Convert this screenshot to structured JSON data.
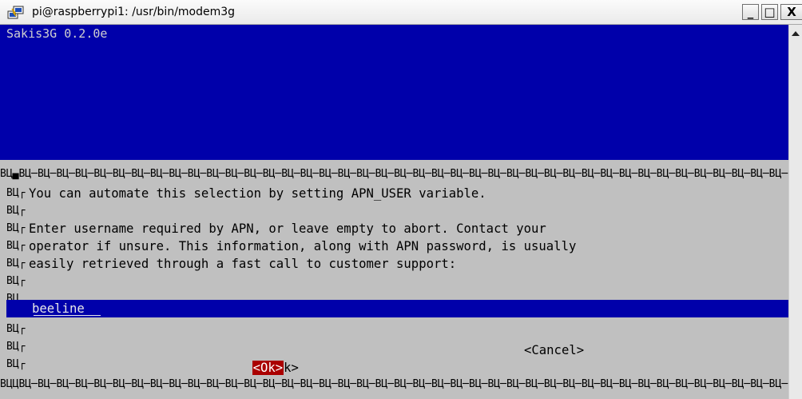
{
  "window": {
    "title": "pi@raspberrypi1: /usr/bin/modem3g",
    "minimize_label": "_",
    "maximize_label": "□",
    "close_label": "X"
  },
  "terminal": {
    "backtitle": "Sakis3G 0.2.0e",
    "border_glyph_row": "ВЦ▄ВЦ─ВЦ─ВЦ─ВЦ─ВЦ─ВЦ─ВЦ─ВЦ─ВЦ─ВЦ─ВЦ─ВЦ─ВЦ─ВЦ─ВЦ─ВЦ─ВЦ─ВЦ─ВЦ─ВЦ─ВЦ─ВЦ─ВЦ─ВЦ─ВЦ─ВЦ─ВЦ─ВЦ─ВЦ─ВЦ─ВЦ─ВЦ─ВЦ─ВЦ─ВЦ─ВЦ─ВЦ─ВЦ─ВЦ─ВЦ─ВЦ─ВЦ─ВЦ─ВЦ─",
    "border_glyph_row_bottom": "ВЦЦВЦ─ВЦ─ВЦ─ВЦ─ВЦ─ВЦ─ВЦ─ВЦ─ВЦ─ВЦ─ВЦ─ВЦ─ВЦ─ВЦ─ВЦ─ВЦ─ВЦ─ВЦ─ВЦ─ВЦ─ВЦ─ВЦ─ВЦ─ВЦ─ВЦ─ВЦ─ВЦ─ВЦ─ВЦ─ВЦ─ВЦ─ВЦ─ВЦ─ВЦ─ВЦ─ВЦ─ВЦ─ВЦ─ВЦ─ВЦ─ВЦ─ВЦ─ВЦ─ВЦ─",
    "left_glyph": "ВЦ┌",
    "left_glyph_plain": "ВЦ"
  },
  "dialog": {
    "lines": [
      "You can automate this selection by setting APN_USER variable.",
      "",
      "Enter username required by APN, or leave empty to abort. Contact your",
      "operator if unsure. This information, along with APN password, is usually",
      "easily retrieved through a fast call to customer support:"
    ],
    "input_value": "beeline",
    "ok_label": "<Ok>",
    "ok_tail": "k>",
    "cancel_label": "<Cancel>"
  },
  "colors": {
    "terminal_blue": "#0000aa",
    "dialog_gray": "#c0c0c0",
    "ok_red": "#aa0000"
  }
}
